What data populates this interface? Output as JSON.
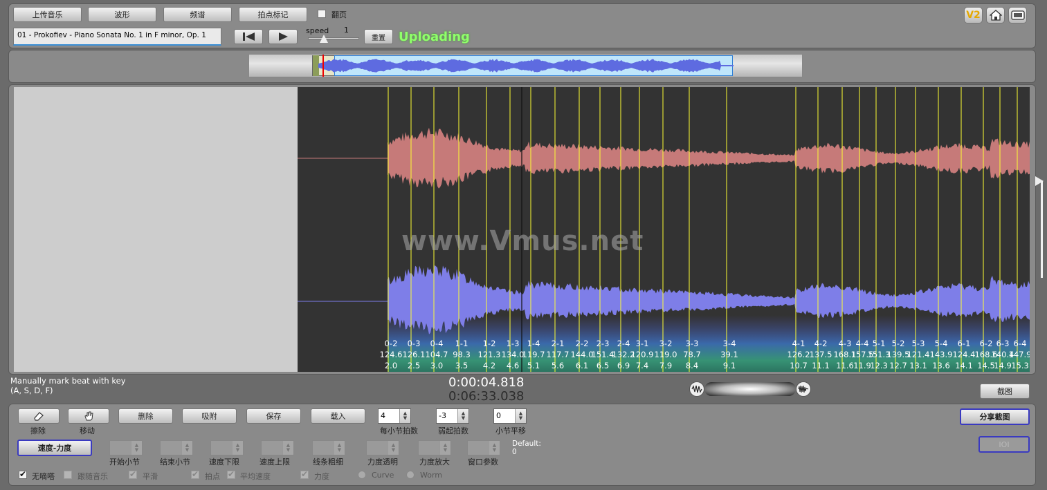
{
  "toolbar": {
    "upload_music": "上传音乐",
    "waveform": "波形",
    "spectrum": "频谱",
    "beat_mark": "拍点标记",
    "page_flip_label": "翻页",
    "song_title": "01 - Prokofiev - Piano Sonata No. 1 in F minor, Op. 1",
    "speed_label": "speed",
    "speed_value": "1",
    "reset_label": "重置",
    "status": "Uploading",
    "v2_badge": "V2"
  },
  "overview": {
    "selection_start": 0.115,
    "selection_end": 0.87,
    "playhead": 0.134
  },
  "watermark": "www.Vmus.net",
  "beats": [
    {
      "label": "0-2",
      "tempo": "124.6",
      "time": "2.0"
    },
    {
      "label": "0-3",
      "tempo": "126.1",
      "time": "2.5"
    },
    {
      "label": "0-4",
      "tempo": "104.7",
      "time": "3.0"
    },
    {
      "label": "1-1",
      "tempo": "98.3",
      "time": "3.5"
    },
    {
      "label": "1-2",
      "tempo": "121.3",
      "time": "4.2"
    },
    {
      "label": "1-3",
      "tempo": "134.0",
      "time": "4.6"
    },
    {
      "label": "1-4",
      "tempo": "119.7",
      "time": "5.1"
    },
    {
      "label": "2-1",
      "tempo": "117.7",
      "time": "5.6"
    },
    {
      "label": "2-2",
      "tempo": "144.0",
      "time": "6.1"
    },
    {
      "label": "2-3",
      "tempo": "151.4",
      "time": "6.5"
    },
    {
      "label": "2-4",
      "tempo": "132.2",
      "time": "6.9"
    },
    {
      "label": "3-1",
      "tempo": "120.9",
      "time": "7.4"
    },
    {
      "label": "3-2",
      "tempo": "119.0",
      "time": "7.9"
    },
    {
      "label": "3-3",
      "tempo": "78.7",
      "time": "8.4"
    },
    {
      "label": "3-4",
      "tempo": "39.1",
      "time": "9.1"
    },
    {
      "label": "4-1",
      "tempo": "126.2",
      "time": "10.7"
    },
    {
      "label": "4-2",
      "tempo": "137.5",
      "time": "11.1"
    },
    {
      "label": "4-3",
      "tempo": "168.1",
      "time": "11.6"
    },
    {
      "label": "4-4",
      "tempo": "157.5",
      "time": "11.9"
    },
    {
      "label": "5-1",
      "tempo": "151.3",
      "time": "12.3"
    },
    {
      "label": "5-2",
      "tempo": "139.5",
      "time": "12.7"
    },
    {
      "label": "5-3",
      "tempo": "121.4",
      "time": "13.1"
    },
    {
      "label": "5-4",
      "tempo": "143.9",
      "time": "13.6"
    },
    {
      "label": "6-1",
      "tempo": "124.4",
      "time": "14.1"
    },
    {
      "label": "6-2",
      "tempo": "168.6",
      "time": "14.5"
    },
    {
      "label": "6-3",
      "tempo": "140.4",
      "time": "14.9"
    },
    {
      "label": "6-4",
      "tempo": "147.9",
      "time": "15.3"
    }
  ],
  "info": {
    "manual_line1": "Manually mark beat with key",
    "manual_line2": "(A, S, D, F)",
    "current_time": "0:00:04.818",
    "total_time": "0:06:33.038",
    "screenshot": "截图"
  },
  "controls": {
    "erase": "擦除",
    "move": "移动",
    "delete": "删除",
    "snap": "吸附",
    "save": "保存",
    "load": "载入",
    "beats_per_bar": {
      "value": "4",
      "label": "每小节拍数"
    },
    "pickup_beats": {
      "value": "-3",
      "label": "弱起拍数"
    },
    "bar_offset": {
      "value": "0",
      "label": "小节平移"
    },
    "share_screenshot": "分享截图",
    "ioi": "IOI",
    "tempo_dynamics": "速度-力度",
    "start_bar": "开始小节",
    "end_bar": "结束小节",
    "tempo_min": "速度下限",
    "tempo_max": "速度上限",
    "line_width": "线条粗细",
    "dyn_transparency": "力度透明",
    "dyn_zoom": "力度放大",
    "window_param": "窗口参数",
    "default_label": "Default:",
    "default_value": "0",
    "no_click": "无嘀嗒",
    "follow_music": "跟随音乐",
    "smooth": "平滑",
    "beat_point": "拍点",
    "avg_tempo": "平均速度",
    "dynamics": "力度",
    "curve": "Curve",
    "worm": "Worm"
  },
  "colors": {
    "upper_wave": "#c67a79",
    "lower_wave": "#7e7ee8",
    "beat_line": "#ffff33",
    "status": "#8fff6a"
  }
}
